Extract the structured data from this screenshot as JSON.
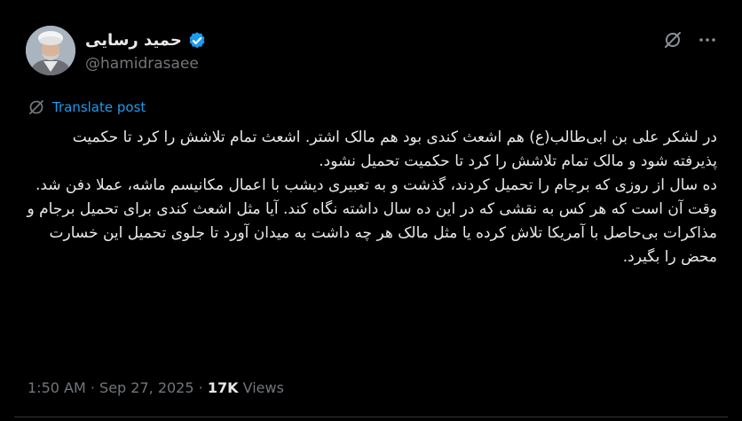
{
  "author": {
    "display_name": "حمید رسایی",
    "handle": "@hamidrasaee",
    "verified": true
  },
  "icons": {
    "verified": "verified-badge-icon",
    "grok": "grok-icon",
    "more": "more-options-icon",
    "translate": "translate-icon"
  },
  "translate": {
    "label": "Translate post"
  },
  "post": {
    "paragraphs": [
      "در لشکر علی بن ابی‌طالب(ع) هم اشعث کندی بود هم مالک اشتر. اشعث تمام تلاشش را کرد تا حکمیت پذیرفته شود و مالک تمام تلاشش را کرد تا حکمیت تحمیل نشود.",
      "ده سال از روزی که برجام را تحمیل کردند، گذشت و به تعبیری دیشب با اعمال مکانیسم ماشه، عملا دفن شد.",
      "وقت آن است که هر کس به نقشی که در این ده سال داشته نگاه کند. آیا مثل اشعث کندی برای تحمیل برجام و مذاکرات بی‌حاصل با آمریکا تلاش کرده یا مثل مالک هر چه داشت به میدان آورد تا جلوی تحمیل این خسارت محض را بگیرد."
    ]
  },
  "meta": {
    "time": "1:50 AM",
    "separator": "·",
    "date": "Sep 27, 2025",
    "views_count": "17K",
    "views_label": "Views"
  },
  "colors": {
    "background": "#000000",
    "text": "#e7e9ea",
    "secondary": "#71767b",
    "accent": "#1d9bf0"
  }
}
